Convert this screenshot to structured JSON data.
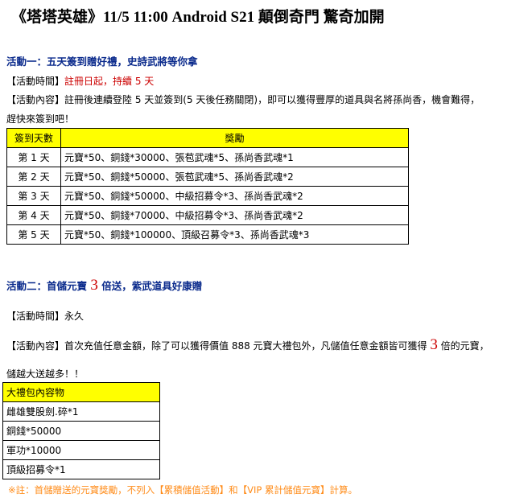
{
  "title": "《塔塔英雄》11/5 11:00 Android S21 顛倒奇門 驚奇加開",
  "event1": {
    "heading": "活動一：五天簽到贈好禮，史詩武將等你拿",
    "time_label": "【活動時間】",
    "time_value": "註冊日起，持續 5 天",
    "content_line1": "【活動內容】註冊後連續登陸 5 天並簽到(5 天後任務關閉)，即可以獲得豐厚的道具與名將孫尚香，機會難得，",
    "content_line2": "趕快來簽到吧！",
    "table": {
      "headers": [
        "簽到天數",
        "獎勵"
      ],
      "rows": [
        [
          "第 1 天",
          "元寶*50、銅錢*30000、張苞武魂*5、孫尚香武魂*1"
        ],
        [
          "第 2 天",
          "元寶*50、銅錢*50000、張苞武魂*5、孫尚香武魂*2"
        ],
        [
          "第 3 天",
          "元寶*50、銅錢*50000、中級招募令*3、孫尚香武魂*2"
        ],
        [
          "第 4 天",
          "元寶*50、銅錢*70000、中級招募令*3、孫尚香武魂*2"
        ],
        [
          "第 5 天",
          "元寶*50、銅錢*100000、頂級召募令*3、孫尚香武魂*3"
        ]
      ]
    }
  },
  "event2": {
    "heading_pre": "活動二：首儲元寶 ",
    "heading_num": "3",
    "heading_post": " 倍送，紫武道具好康贈",
    "time_label": "【活動時間】",
    "time_value": "永久",
    "content_pre": "【活動內容】首次充值任意金額，除了可以獲得價值 888 元寶大禮包外，凡儲值任意金額皆可獲得 ",
    "content_num": "3",
    "content_post": " 倍的元寶，",
    "content_line2": "儲越大送越多！！",
    "package": {
      "header": "大禮包內容物",
      "items": [
        "雌雄雙股劍.碎*1",
        "銅錢*50000",
        "軍功*10000",
        "頂級招募令*1"
      ]
    },
    "note": "※註：首儲贈送的元寶獎勵，不列入【累積儲值活動】和【VIP 累計儲值元寶】計算。"
  }
}
